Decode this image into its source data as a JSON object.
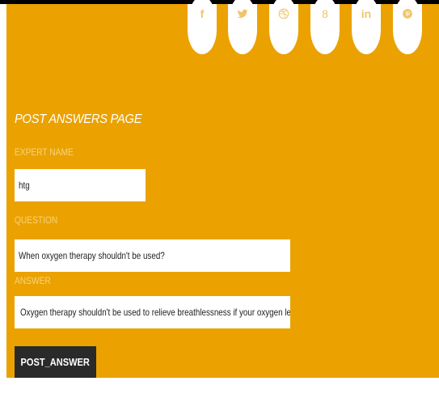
{
  "social_links": [
    {
      "name": "facebook",
      "icon": "facebook-icon",
      "glyph": "f"
    },
    {
      "name": "twitter",
      "icon": "twitter-icon",
      "glyph": ""
    },
    {
      "name": "dribbble",
      "icon": "dribbble-icon",
      "glyph": ""
    },
    {
      "name": "google-plus",
      "icon": "google-plus-icon",
      "glyph": "8"
    },
    {
      "name": "linkedin",
      "icon": "linkedin-icon",
      "glyph": "in"
    },
    {
      "name": "pinterest",
      "icon": "pinterest-icon",
      "glyph": ""
    }
  ],
  "form": {
    "title": "POST ANSWERS PAGE",
    "expert_name": {
      "label": "EXPERT NAME",
      "value": "htg"
    },
    "question": {
      "label": "QUESTION",
      "value": "When oxygen therapy shouldn't be used?"
    },
    "answer": {
      "label": "ANSWER",
      "value": "Oxygen therapy shouldn't be used to relieve breathlessness if your oxygen levels are norm"
    },
    "submit_label": "POST_ANSWER"
  },
  "colors": {
    "panel_background": "#eba200",
    "label_text": "#f7d27a",
    "title_text": "#ffffff",
    "button_background": "#2a2a2a",
    "icon_tint": "#f0c46a"
  }
}
